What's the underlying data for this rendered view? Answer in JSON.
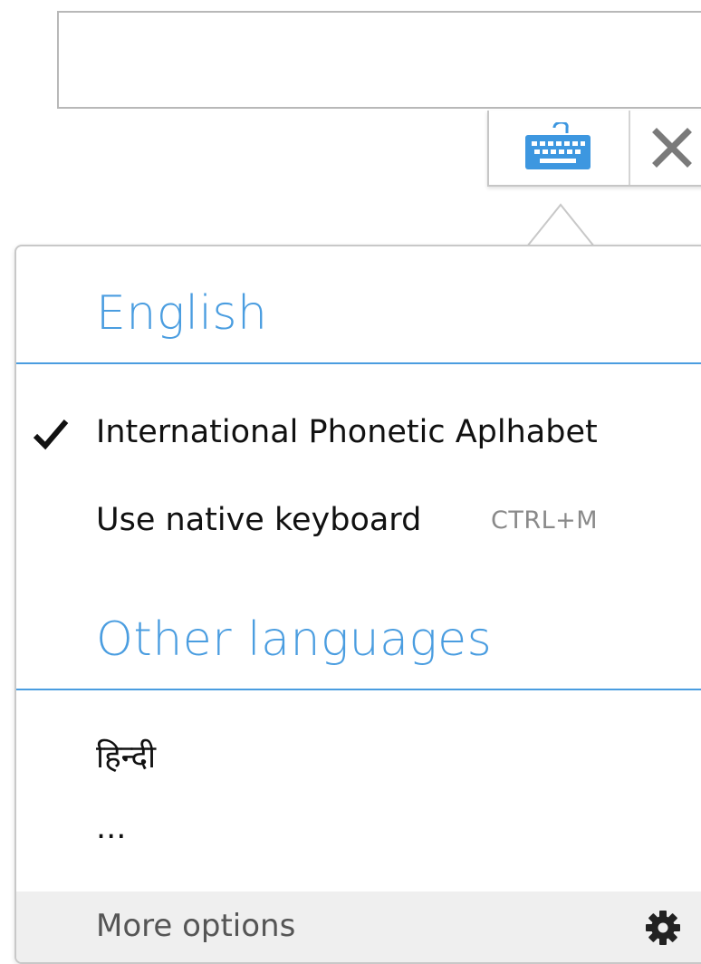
{
  "menu": {
    "english_section": {
      "title": "English",
      "items": [
        {
          "label": "International Phonetic Aplhabet",
          "selected": true
        },
        {
          "label": "Use native keyboard",
          "shortcut": "CTRL+M"
        }
      ]
    },
    "other_section": {
      "title": "Other languages",
      "items": [
        {
          "label": "हिन्दी"
        },
        {
          "label": "..."
        }
      ]
    },
    "footer": {
      "label": "More options"
    }
  },
  "icons": {
    "keyboard": "keyboard-icon",
    "close": "close-icon",
    "check": "checkmark-icon",
    "gear": "gear-icon"
  },
  "colors": {
    "accent": "#4a9de0",
    "keyboard_icon": "#3d97e0",
    "close_icon": "#7a7a7a",
    "footer_bg": "#efefef"
  }
}
